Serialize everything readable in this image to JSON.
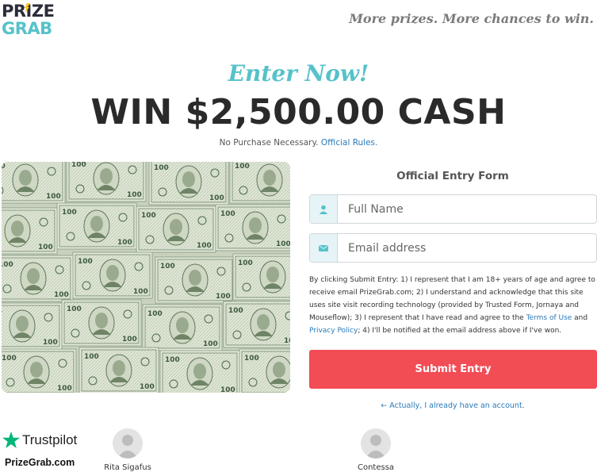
{
  "brand": {
    "logo_line1": "PRIZE",
    "logo_line2": "GRAB",
    "logo_accent": "#56c2c9",
    "logo_dark": "#2b2d3a"
  },
  "header": {
    "tagline": "More prizes. More chances to win."
  },
  "hero": {
    "enter_now": "Enter Now!",
    "title": "WIN $2,500.00 CASH",
    "no_purchase": "No Purchase Necessary.",
    "official_rules": "Official Rules."
  },
  "form": {
    "title": "Official Entry Form",
    "name_placeholder": "Full Name",
    "email_placeholder": "Email address",
    "name_icon": "user-icon",
    "email_icon": "envelope-icon",
    "disclaimer_part1": "By clicking Submit Entry: 1) I represent that I am 18+ years of age and agree to receive email PrizeGrab.com; 2) I understand and acknowledge that this site uses site visit recording technology (provided by Trusted Form, Jornaya and Mouseflow); 3) I represent that I have read and agree to the ",
    "terms_link": "Terms of Use",
    "disclaimer_and": " and ",
    "privacy_link": "Privacy Policy",
    "disclaimer_part2": "; 4) I'll be notified at the email address above if I've won.",
    "submit_label": "Submit Entry",
    "already_label": "← Actually, I already have an account."
  },
  "footer": {
    "trustpilot_label": "Trustpilot",
    "trustpilot_domain": "PrizeGrab.com",
    "reviewers": [
      {
        "name": "Rita Sigafus"
      },
      {
        "name": "Contessa"
      }
    ]
  },
  "colors": {
    "accent": "#56c2c9",
    "submit": "#f24c55",
    "link": "#2a7ab8",
    "trustpilot_star": "#00b67a"
  }
}
